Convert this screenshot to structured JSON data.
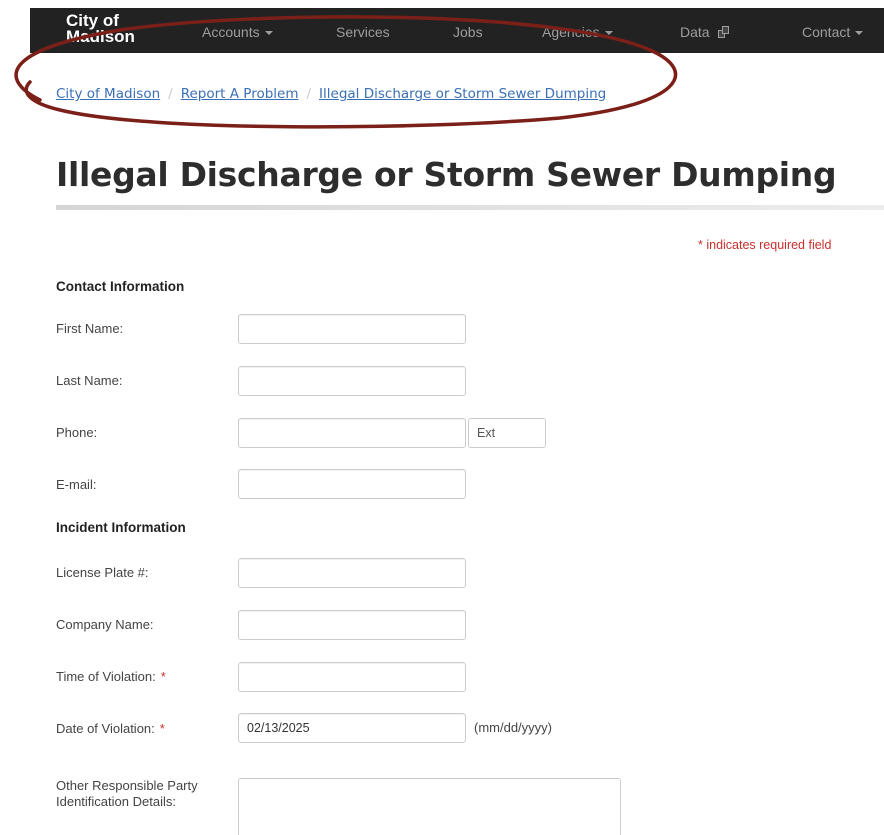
{
  "nav": {
    "brand_line1": "City of",
    "brand_line2": "Madison",
    "items": [
      {
        "label": "Accounts",
        "dropdown": true
      },
      {
        "label": "Services",
        "dropdown": false
      },
      {
        "label": "Jobs",
        "dropdown": false
      },
      {
        "label": "Agencies",
        "dropdown": true
      },
      {
        "label": "Data",
        "icon": "data-icon"
      },
      {
        "label": "Contact",
        "dropdown": true
      }
    ]
  },
  "breadcrumb": [
    "City of Madison",
    "Report A Problem",
    "Illegal Discharge or Storm Sewer Dumping"
  ],
  "page_title": "Illegal Discharge or Storm Sewer Dumping",
  "required_note": "* indicates required field",
  "sections": {
    "contact": "Contact Information",
    "incident": "Incident Information"
  },
  "fields": {
    "first_name": {
      "label": "First Name:",
      "value": ""
    },
    "last_name": {
      "label": "Last Name:",
      "value": ""
    },
    "phone": {
      "label": "Phone:",
      "value": "",
      "ext_placeholder": "Ext"
    },
    "email": {
      "label": "E-mail:",
      "value": ""
    },
    "license_plate": {
      "label": "License Plate #:",
      "value": ""
    },
    "company_name": {
      "label": "Company Name:",
      "value": ""
    },
    "time_of_violation": {
      "label": "Time of Violation:",
      "value": "",
      "required": "*"
    },
    "date_of_violation": {
      "label": "Date of Violation:",
      "value": "02/13/2025",
      "required": "*",
      "hint": "(mm/dd/yyyy)"
    },
    "other_party": {
      "label_line1": "Other Responsible Party",
      "label_line2": "Identification Details:",
      "value": ""
    }
  },
  "colors": {
    "nav_bg": "#222222",
    "link": "#3b6fb6",
    "required": "#c9302c",
    "annotation": "#7b2018"
  }
}
